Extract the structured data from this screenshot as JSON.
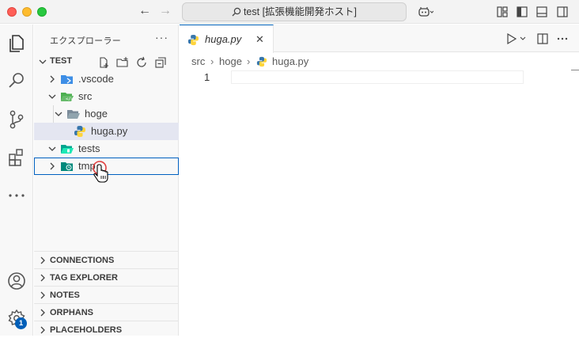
{
  "window": {
    "title": "test [拡張機能開発ホスト]",
    "colors": {
      "accent": "#005fb8",
      "close": "#ff5f57",
      "minimize": "#febc2e",
      "zoom": "#28c840"
    }
  },
  "activity_bar": {
    "items": [
      "files-icon",
      "search-icon",
      "source-control-icon",
      "extensions-icon",
      "more-icon"
    ],
    "accounts_icon": "account-icon",
    "settings_icon": "gear-icon",
    "settings_badge": "1"
  },
  "sidebar": {
    "title": "エクスプローラー",
    "more": "···",
    "workspace": "TEST",
    "tree": [
      {
        "label": ".vscode",
        "type": "folder",
        "expanded": false
      },
      {
        "label": "src",
        "type": "folder",
        "expanded": true
      },
      {
        "label": "hoge",
        "type": "folder",
        "expanded": true
      },
      {
        "label": "huga.py",
        "type": "file",
        "selected": true
      },
      {
        "label": "tests",
        "type": "folder",
        "expanded": true
      },
      {
        "label": "tmp",
        "type": "folder",
        "expanded": false,
        "focused": true
      }
    ],
    "sections": [
      "CONNECTIONS",
      "TAG EXPLORER",
      "NOTES",
      "ORPHANS",
      "PLACEHOLDERS"
    ]
  },
  "editor": {
    "tab": {
      "label": "huga.py",
      "close": "✕"
    },
    "breadcrumb": [
      "src",
      "hoge",
      "huga.py"
    ],
    "lines": [
      "1"
    ]
  }
}
